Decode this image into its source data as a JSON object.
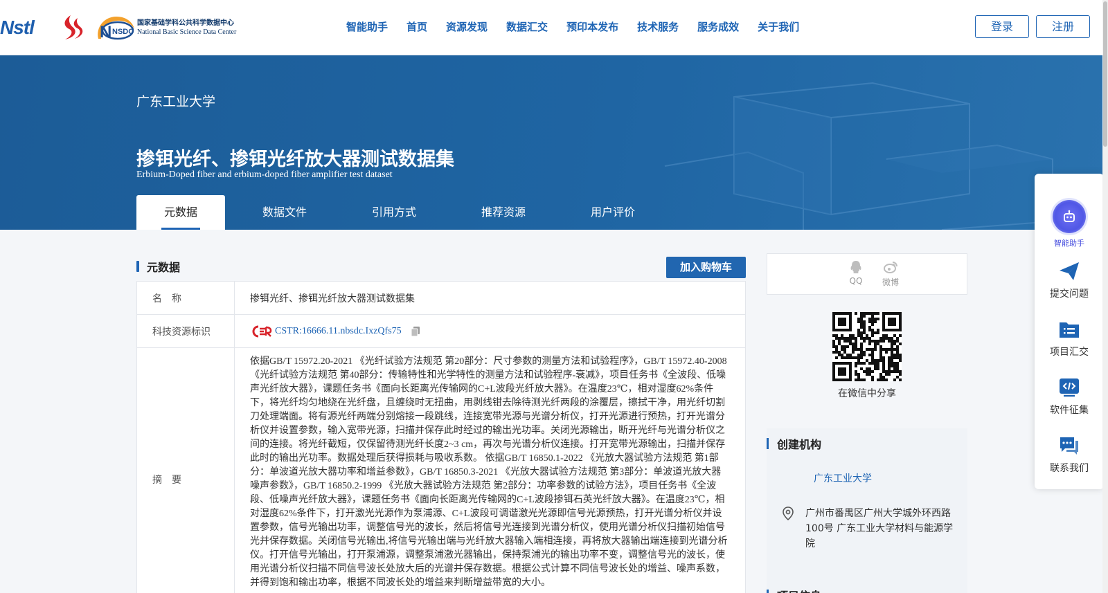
{
  "header": {
    "logo_text": "Nstl",
    "nsdc_mark": "NSDC",
    "nsdc_cn": "国家基础学科公共科学数据中心",
    "nsdc_en": "National Basic Science Data Center",
    "nav": [
      "智能助手",
      "首页",
      "资源发现",
      "数据汇交",
      "预印本发布",
      "技术服务",
      "服务成效",
      "关于我们"
    ],
    "login": "登录",
    "register": "注册"
  },
  "banner": {
    "institution": "广东工业大学",
    "title": "掺铒光纤、掺铒光纤放大器测试数据集",
    "subtitle": "Erbium-Doped fiber and erbium-doped fiber amplifier test dataset",
    "tabs": [
      "元数据",
      "数据文件",
      "引用方式",
      "推荐资源",
      "用户评价"
    ]
  },
  "metadata": {
    "section_title": "元数据",
    "cart_button": "加入购物车",
    "name_label": "名　称",
    "name_value": "掺铒光纤、掺铒光纤放大器测试数据集",
    "id_label": "科技资源标识",
    "id_value": "CSTR:16666.11.nbsdc.IxzQfs75",
    "abstract_label": "摘　要",
    "abstract_value": "依据GB/T 15972.20-2021 《光纤试验方法规范 第20部分：尺寸参数的测量方法和试验程序》，GB/T 15972.40-2008 《光纤试验方法规范 第40部分：传输特性和光学特性的测量方法和试验程序-衰减》，项目任务书《全波段、低噪声光纤放大器》，课题任务书《面向长距离光传输网的C+L波段光纤放大器》。在温度23℃，相对湿度62%条件下，将光纤均匀地绕在光纤盘，且缠绕时无扭曲，用剥线钳去除待测光纤两段的涂覆层，擦拭干净，用光纤切割刀处理端面。将有源光纤两端分别熔接一段跳线，连接宽带光源与光谱分析仪，打开光源进行预热，打开光谱分析仪并设置参数，输入宽带光源，扫描并保存此时经过的输出光功率。关闭光源输出，断开光纤与光谱分析仪之间的连接。将光纤截短，仅保留待测光纤长度2~3 cm，再次与光谱分析仪连接。打开宽带光源输出，扫描并保存此时的输出光功率。数据处理后获得损耗与吸收系数。 依据GB/T 16850.1-2022 《光放大器试验方法规范 第1部分：单波道光放大器功率和增益参数》，GB/T 16850.3-2021 《光放大器试验方法规范 第3部分：单波道光放大器噪声参数》，GB/T 16850.2-1999 《光放大器试验方法规范 第2部分：功率参数的试验方法》，项目任务书《全波段、低噪声光纤放大器》，课题任务书《面向长距离光传输网的C+L波段掺铒石英光纤放大器》。在温度23℃，相对湿度62%条件下，打开激光光源作为泵浦源、C+L波段可调谐激光光源即信号光源预热，打开光谱分析仪并设置参数，信号光输出功率，调整信号光的波长，然后将信号光连接到光谱分析仪，使用光谱分析仪扫描初始信号光并保存数据。关闭信号光输出,将信号光输出端与光纤放大器输入端相连接，再将放大器输出端连接到光谱分析仪。打开信号光输出，打开泵浦源，调整泵浦激光器输出，保持泵浦光的输出功率不变，调整信号光的波长，使用光谱分析仪扫描不同信号波长处放大后的光谱并保存数据。根据公式计算不同信号波长处的增益、噪声系数，并得到饱和输出功率，根据不同波长处的增益来判断增益带宽的大小。"
  },
  "share": {
    "qq": "QQ",
    "weibo": "微博",
    "qr_caption": "在微信中分享"
  },
  "org": {
    "title": "创建机构",
    "name": "广东工业大学",
    "address": "广州市番禺区广州大学城外环西路100号 广东工业大学材料与能源学院",
    "next_title": "项目信息"
  },
  "float_bar": {
    "ai": "智能助手",
    "submit": "提交问题",
    "project": "项目汇交",
    "software": "软件征集",
    "contact": "联系我们"
  },
  "colors": {
    "brand_blue": "#1e64b4",
    "banner_blue": "#1f65a3",
    "ai_purple": "#5057e6"
  }
}
